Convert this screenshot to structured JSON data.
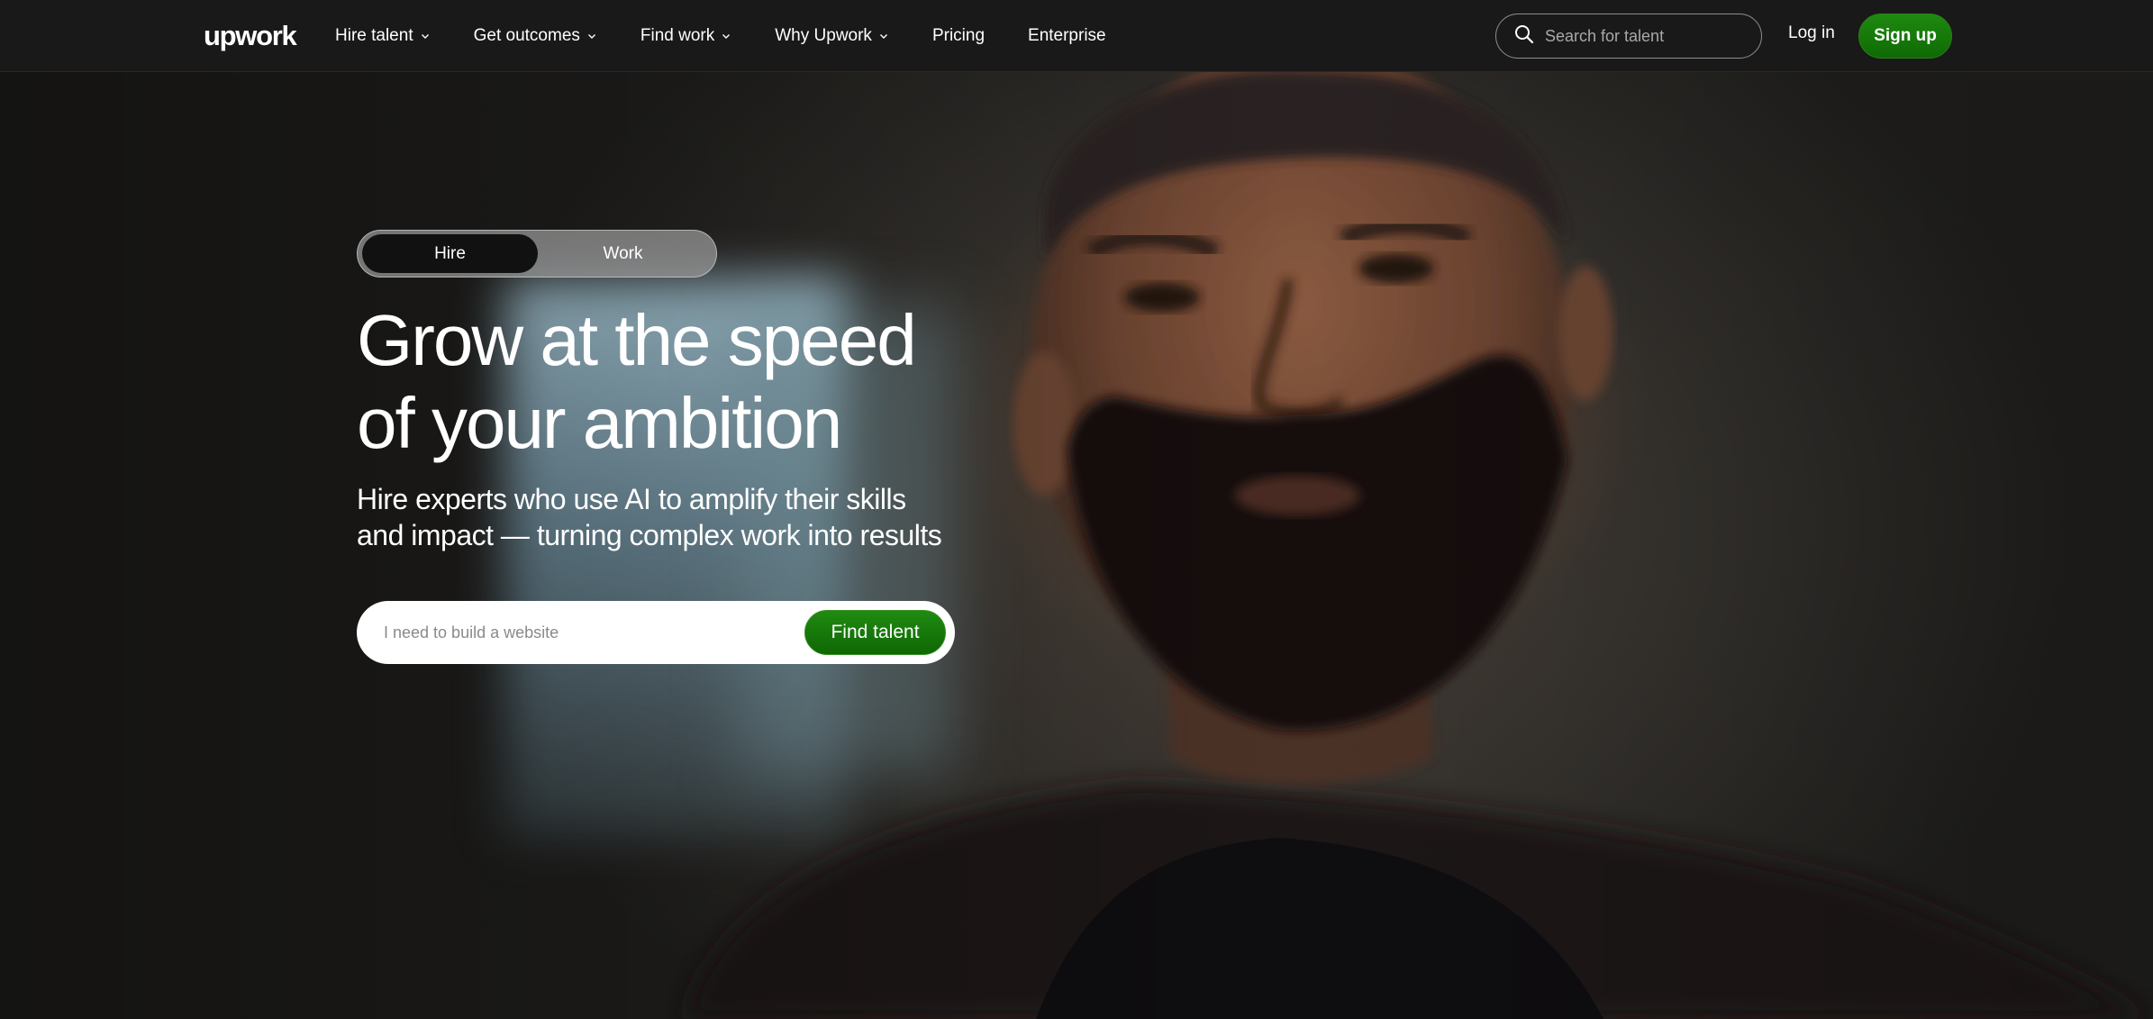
{
  "brand": {
    "logo_text": "upwork"
  },
  "nav": {
    "items": [
      {
        "label": "Hire talent",
        "dropdown": true
      },
      {
        "label": "Get outcomes",
        "dropdown": true
      },
      {
        "label": "Find work",
        "dropdown": true
      },
      {
        "label": "Why Upwork",
        "dropdown": true
      },
      {
        "label": "Pricing",
        "dropdown": false
      },
      {
        "label": "Enterprise",
        "dropdown": false
      }
    ],
    "search": {
      "placeholder": "Search for talent",
      "icon": "search-icon"
    },
    "login_label": "Log in",
    "signup_label": "Sign up"
  },
  "hero": {
    "toggle": {
      "options": [
        "Hire",
        "Work"
      ],
      "selected": "Hire"
    },
    "headline_line1": "Grow at the speed",
    "headline_line2": "of your ambition",
    "subhead_line1": "Hire experts who use AI to amplify their skills",
    "subhead_line2": "and impact — turning complex work into results",
    "search": {
      "placeholder": "I need to build a website",
      "button_label": "Find talent"
    }
  },
  "colors": {
    "accent_green": "#14780a",
    "nav_background": "#191919",
    "toggle_selected": "#111111"
  }
}
